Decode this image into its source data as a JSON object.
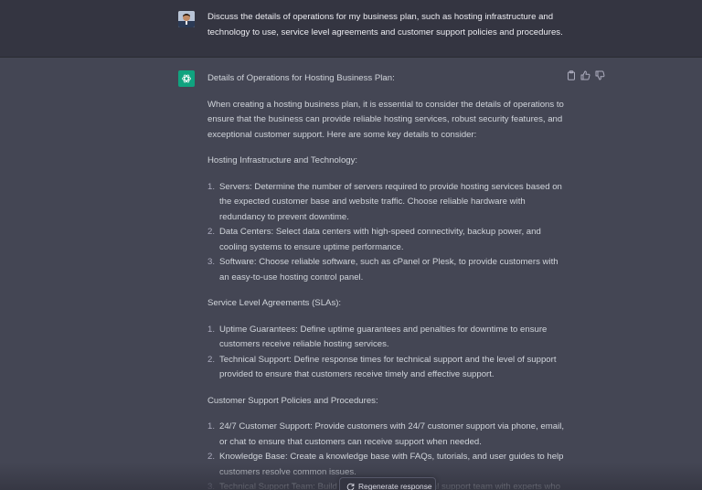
{
  "user_message": {
    "line1": "Discuss the details of operations for my business plan, such as hosting infrastructure and",
    "line2": "technology to use, service level agreements and customer support policies and procedures."
  },
  "assistant": {
    "title": "Details of Operations for Hosting Business Plan:",
    "intro": "When creating a hosting business plan, it is essential to consider the details of operations to ensure that the business can provide reliable hosting services, robust security features, and exceptional customer support. Here are some key details to consider:",
    "sections": [
      {
        "heading": "Hosting Infrastructure and Technology:",
        "items": [
          {
            "num": "1.",
            "text": "Servers: Determine the number of servers required to provide hosting services based on the expected customer base and website traffic. Choose reliable hardware with redundancy to prevent downtime."
          },
          {
            "num": "2.",
            "text": "Data Centers: Select data centers with high-speed connectivity, backup power, and cooling systems to ensure uptime performance."
          },
          {
            "num": "3.",
            "text": "Software: Choose reliable software, such as cPanel or Plesk, to provide customers with an easy-to-use hosting control panel."
          }
        ]
      },
      {
        "heading": "Service Level Agreements (SLAs):",
        "items": [
          {
            "num": "1.",
            "text": "Uptime Guarantees: Define uptime guarantees and penalties for downtime to ensure customers receive reliable hosting services."
          },
          {
            "num": "2.",
            "text": "Technical Support: Define response times for technical support and the level of support provided to ensure that customers receive timely and effective support."
          }
        ]
      },
      {
        "heading": "Customer Support Policies and Procedures:",
        "items": [
          {
            "num": "1.",
            "text": "24/7 Customer Support: Provide customers with 24/7 customer support via phone, email, or chat to ensure that customers can receive support when needed."
          },
          {
            "num": "2.",
            "text": "Knowledge Base: Create a knowledge base with FAQs, tutorials, and user guides to help customers resolve common issues."
          },
          {
            "num": "3.",
            "text": "Technical Support Team: Build a                                    al support team with experts who"
          }
        ]
      }
    ]
  },
  "actions": {
    "copy_icon": "clipboard-icon",
    "like_icon": "thumbs-up-icon",
    "dislike_icon": "thumbs-down-icon"
  },
  "regenerate": {
    "label": "Regenerate response",
    "icon": "refresh-icon"
  },
  "colors": {
    "user_bg": "#343541",
    "assistant_bg": "#444654",
    "logo_green": "#10a37f"
  }
}
